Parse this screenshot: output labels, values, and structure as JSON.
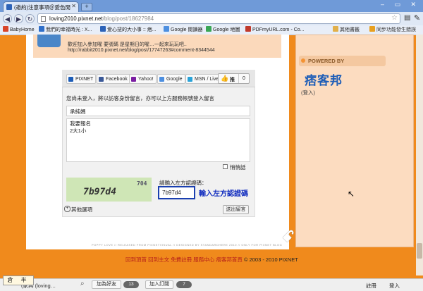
{
  "browser": {
    "tab_title": "(邀約)注意事項＠愛色閒…",
    "new_tab": "+",
    "window_controls": "–  ▭  ✕",
    "url_host": "loving2010.pixnet.net",
    "url_path": "/blog/post/18627984",
    "bookmarks": [
      {
        "label": "BabyHome",
        "color": "#d8452a"
      },
      {
        "label": "我們的幸福時光 : X...",
        "color": "#2f6fc9"
      },
      {
        "label": "爱心扭的大小事 :: 痞...",
        "color": "#2d63b8"
      },
      {
        "label": "Google 閱讀器",
        "color": "#4d8fe0"
      },
      {
        "label": "Google 地圖",
        "color": "#3aa655"
      },
      {
        "label": "PDFmyURL.com - Co...",
        "color": "#c0392b"
      }
    ],
    "other_bookmarks": "其他書籤",
    "sync_error": "同步功能發生錯誤"
  },
  "comment": {
    "line1": "歡迎加入參加喔 要號碼 是星期日的喔…一起來玩玩吧..",
    "line2": "http://rabbit2010.pixnet.net/blog/post/17747263#comment-8344544"
  },
  "form": {
    "services": [
      "PIXNET",
      "Facebook",
      "Yahoo!",
      "Google",
      "MSN / Live"
    ],
    "like_label": "推",
    "like_count": "0",
    "login_prompt": "您尚未登入，將以訪客身份留言，亦可以上方服務帳號登入留言",
    "name_value": "承純媽",
    "message_value": "我要報名\n2大1小",
    "private_label": "悄悄話",
    "captcha_prompt": "請輸入左方認證碼：",
    "captcha_code": "7b97d4",
    "captcha_small": "704",
    "captcha_value": "7b97d4",
    "captcha_hint": "輸入左方認證碼",
    "more_options": "其他選項",
    "submit_label": "送出留言"
  },
  "page_footer_credit": "POPPY LOVE  //  RELEASED FROM PIXNETVISUAL  //  DESIGNED BY STANDARDHERE 2010  //  ONLY FOR PIXNET BLOG",
  "sidebar": {
    "powered_by": "POWERED BY",
    "logo_text": "痞客邦",
    "login_link": "(登入)"
  },
  "footer_links": {
    "links": [
      "回到頂首",
      "回到主文",
      "免費註冊",
      "服務中心",
      "痞客邦首頁"
    ],
    "copyright": "© 2003 - 2010 PIXNET"
  },
  "statusbar": {
    "ime_full": "倉",
    "ime_half": "半",
    "title_text": "(家具 (loving…",
    "add_friend": "加為好友",
    "friend_count": "13",
    "subscribe": "加入訂閱",
    "sub_count": "7",
    "register": "註冊",
    "login": "登入"
  }
}
